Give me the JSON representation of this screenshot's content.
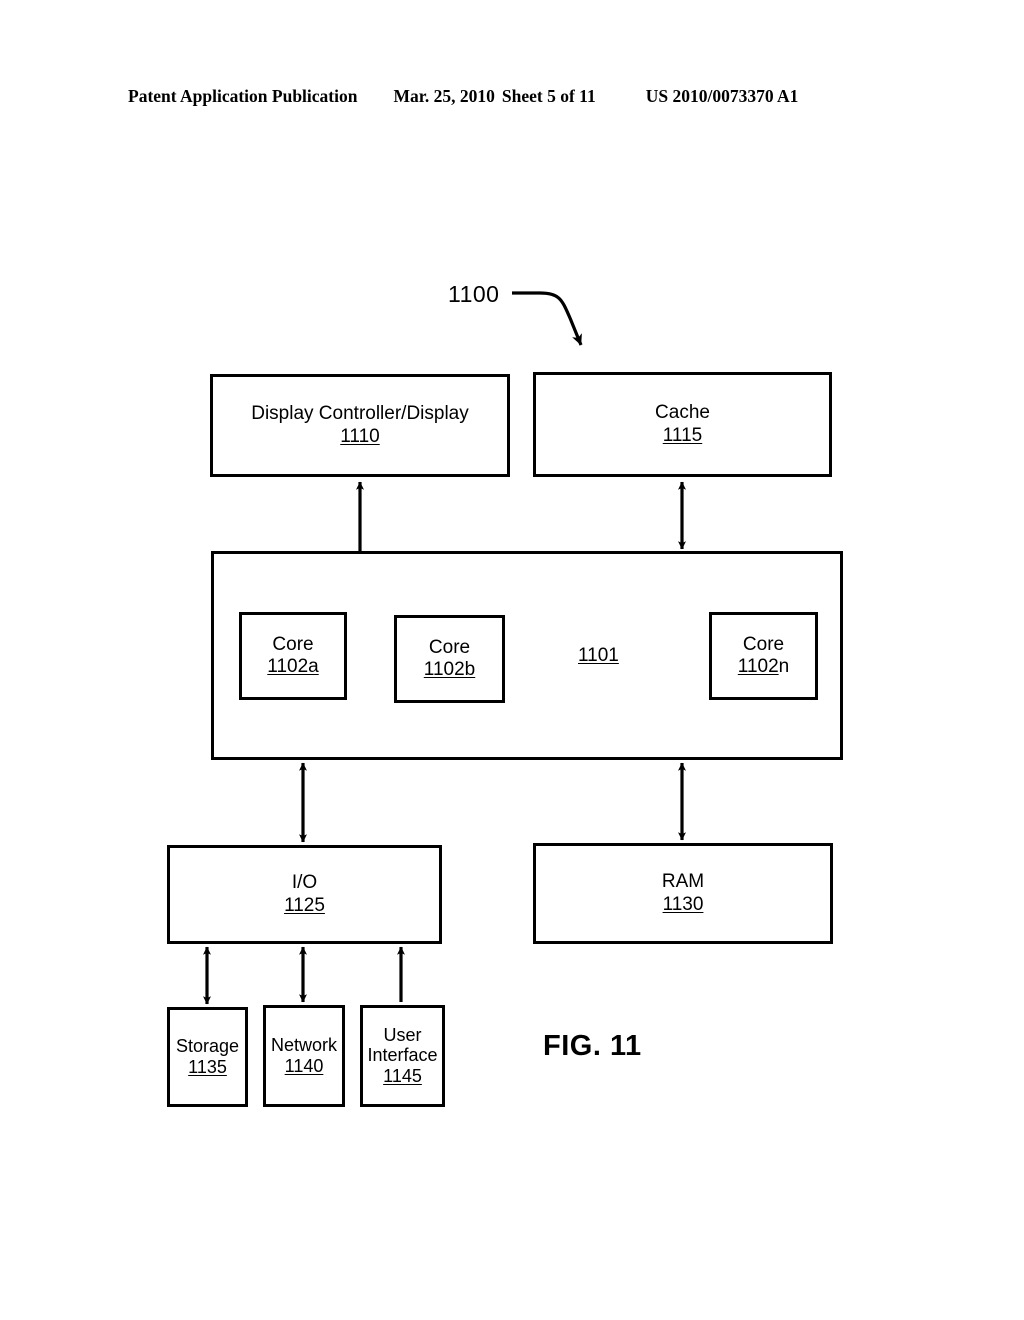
{
  "header": {
    "publication": "Patent Application Publication",
    "date": "Mar. 25, 2010",
    "sheet": "Sheet 5 of 11",
    "patent_number": "US 2010/0073370 A1"
  },
  "figure": {
    "label": "FIG. 11",
    "callout_ref": "1100",
    "nodes": {
      "display_controller": {
        "title": "Display Controller/Display",
        "ref": "1110"
      },
      "cache": {
        "title": "Cache",
        "ref": "1115"
      },
      "processor": {
        "ref": "1101"
      },
      "core_a": {
        "title": "Core",
        "ref": "1102a"
      },
      "core_b": {
        "title": "Core",
        "ref": "1102b"
      },
      "core_n": {
        "title": "Core",
        "ref_num": "1102",
        "ref_suffix": "n"
      },
      "io": {
        "title": "I/O",
        "ref": "1125"
      },
      "ram": {
        "title": "RAM",
        "ref": "1130"
      },
      "storage": {
        "title": "Storage",
        "ref": "1135"
      },
      "network": {
        "title": "Network",
        "ref": "1140"
      },
      "user_interface": {
        "title": "User Interface",
        "ref": "1145"
      }
    },
    "colors": {
      "stroke": "#000000",
      "fill": "#ffffff"
    }
  }
}
